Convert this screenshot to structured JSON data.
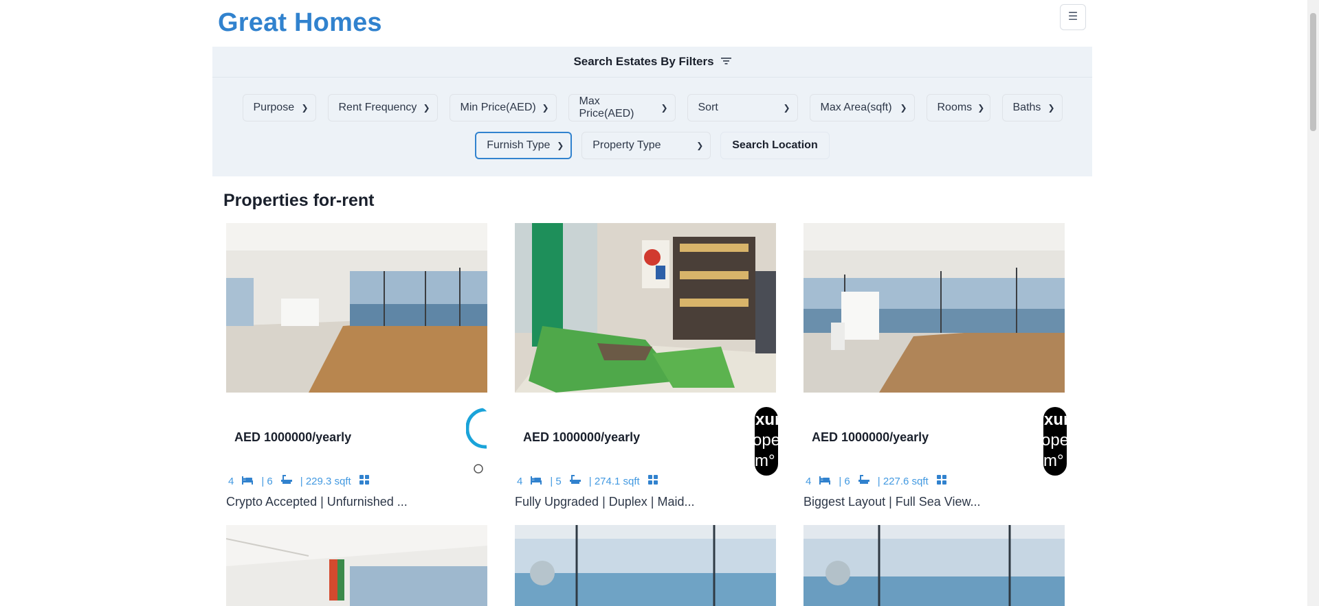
{
  "header": {
    "logo": "Great Homes",
    "menu_icon": "hamburger-icon"
  },
  "filters": {
    "heading": "Search Estates By Filters",
    "row1": [
      {
        "label": "Purpose"
      },
      {
        "label": "Rent Frequency"
      },
      {
        "label": "Min Price(AED)"
      },
      {
        "label": "Max Price(AED)"
      },
      {
        "label": "Sort"
      },
      {
        "label": "Max Area(sqft)"
      },
      {
        "label": "Rooms"
      },
      {
        "label": "Baths"
      }
    ],
    "row2": [
      {
        "label": "Furnish Type"
      },
      {
        "label": "Property Type"
      }
    ],
    "search_location": "Search Location"
  },
  "section_title": "Properties for-rent",
  "properties": [
    {
      "price": "AED 1000000/yearly",
      "rooms": "4",
      "baths": "| 6",
      "area": "| 229.3 sqft",
      "title": "Crypto Accepted | Unfurnished ..."
    },
    {
      "price": "AED 1000000/yearly",
      "rooms": "4",
      "baths": "| 5",
      "area": "| 274.1 sqft",
      "title": "Fully Upgraded | Duplex | Maid..."
    },
    {
      "price": "AED 1000000/yearly",
      "rooms": "4",
      "baths": "| 6",
      "area": "| 227.6 sqft",
      "title": "Biggest Layout | Full Sea View..."
    }
  ],
  "colors": {
    "accent": "#3182ce",
    "panel": "#edf2f7",
    "stat": "#4299e1"
  }
}
